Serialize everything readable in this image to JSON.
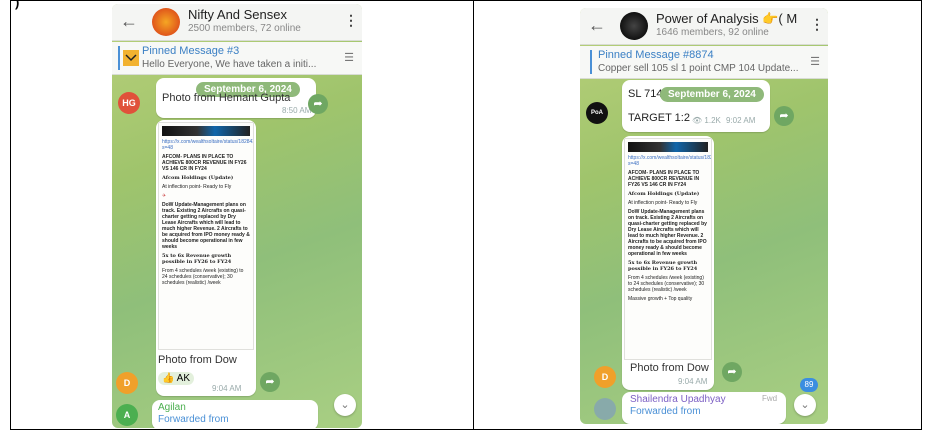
{
  "left": {
    "channel": {
      "title": "Nifty And Sensex",
      "subtitle": "2500 members, 72 online"
    },
    "pinned": {
      "title": "Pinned Message #3",
      "text": "Hello Everyone,  We have taken a initi..."
    },
    "date_pill": "September 6, 2024",
    "msg1": {
      "avatar": "HG",
      "caption": "Photo from Hemant Gupta",
      "time": "8:50 AM"
    },
    "doc": {
      "link": "https://x.com/wealthsoltaire/status/1828435615681003912?s=48",
      "headline": "AFCOM- PLANS IN PLACE TO ACHIEVE 800CR REVENUE IN FY26 VS 146 CR IN FY24",
      "company": "Afcom Holdings (Update)",
      "sub": "At inflection point- Ready to Fly",
      "body": "DoW Update-Management plans on track. Existing 2 Aircrafts on quasi-charter getting  replaced by Dry Lease Aircrafts which will lead to much higher Revenue. 2 Aircrafts to be acquired from IPO money ready & should become operational in few weeks",
      "growth": "5x to 6x Revenue growth possible in FY26 to FY24",
      "schedules": "From 4 schedules /week (existing) to 24 schedules (conservative); 30 schedules (realistic) /week"
    },
    "msg2": {
      "avatar": "D",
      "caption": "Photo from Dow",
      "reactions": "👍 AK",
      "time": "9:04 AM"
    },
    "msg3": {
      "avatar": "A",
      "name": "Agilan",
      "sub": "Forwarded from"
    }
  },
  "right": {
    "channel": {
      "title": "Power of Analysis 👉( M",
      "subtitle": "1646 members, 92 online"
    },
    "pinned": {
      "title": "Pinned Message #8874",
      "text": "Copper sell 105 sl 1 point CMP 104  Update..."
    },
    "date_pill": "September 6, 2024",
    "msg1": {
      "line1": "SL 714",
      "line2": "TARGET 1:2",
      "views": "1.2K",
      "time": "9:02 AM"
    },
    "doc": {
      "link": "https://x.com/wealthsoltaire/status/1828435615681003912?s=48",
      "headline": "AFCOM- PLANS IN PLACE TO ACHIEVE 800CR REVENUE IN FY26 VS 146 CR IN FY24",
      "company": "Afcom Holdings (Update)",
      "sub": "At inflection point- Ready to Fly",
      "body": "DoW Update-Management plans on track. Existing 2 Aircrafts on quasi-charter getting  replaced by Dry Lease Aircrafts which will lead to much higher Revenue. 2 Aircrafts to be acquired from IPO money ready & should become operational in few weeks",
      "growth": "5x to 6x Revenue growth possible in FY26 to FY24",
      "schedules": "From 4 schedules /week (existing) to 24 schedules (conservative); 30 schedules (realistic) /week",
      "quality": "Massive growth + Top quality"
    },
    "msg2": {
      "avatar": "D",
      "caption": "Photo from Dow",
      "time": "9:04 AM"
    },
    "msg3": {
      "name": "Shailendra Upadhyay",
      "sub": "Forwarded from",
      "tag": "Fwd"
    },
    "unread_badge": "89"
  },
  "colors": {
    "accent": "#4a90d6",
    "share": "#6fa762",
    "date_pill": "#8fb97a"
  }
}
